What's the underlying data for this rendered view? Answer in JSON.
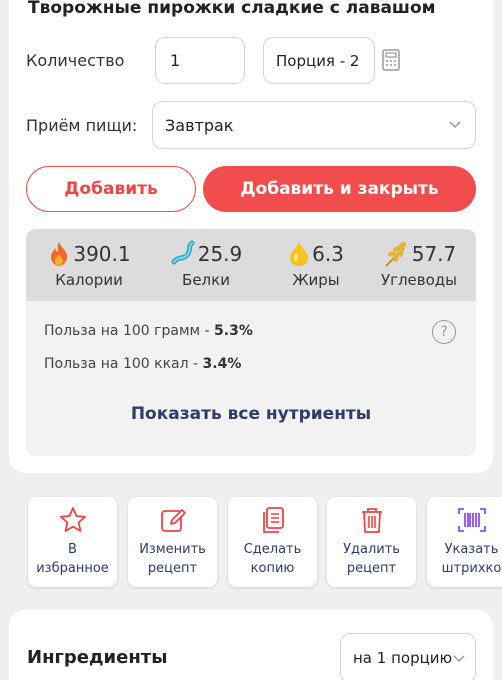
{
  "recipe": {
    "title": "Творожные пирожки сладкие с лавашом"
  },
  "quantity": {
    "label": "Количество",
    "value": "1",
    "unit": "Порция - 2"
  },
  "meal": {
    "label": "Приём пищи:",
    "value": "Завтрак"
  },
  "buttons": {
    "add": "Добавить",
    "add_close": "Добавить и закрыть"
  },
  "macros": [
    {
      "value": "390.1",
      "name": "Калории",
      "icon": "fire-icon"
    },
    {
      "value": "25.9",
      "name": "Белки",
      "icon": "protein-icon"
    },
    {
      "value": "6.3",
      "name": "Жиры",
      "icon": "oil-drop-icon"
    },
    {
      "value": "57.7",
      "name": "Углеводы",
      "icon": "wheat-icon"
    }
  ],
  "benefit": {
    "per_100g_label": "Польза на 100 грамм - ",
    "per_100g_value": "5.3%",
    "per_100kcal_label": "Польза на 100 ккал - ",
    "per_100kcal_value": "3.4%"
  },
  "show_all_nutrients": "Показать все нутриенты",
  "actions": [
    {
      "label": "В\nизбранное",
      "icon": "star-icon"
    },
    {
      "label": "Изменить\nрецепт",
      "icon": "edit-icon"
    },
    {
      "label": "Сделать\nкопию",
      "icon": "copy-icon"
    },
    {
      "label": "Удалить\nрецепт",
      "icon": "trash-icon"
    },
    {
      "label": "Указать\nштрихко",
      "icon": "barcode-icon"
    }
  ],
  "ingredients": {
    "title": "Ингредиенты",
    "portion": "на 1 порцию"
  },
  "colors": {
    "accent": "#f24d4d",
    "link": "#2f3b6a"
  }
}
